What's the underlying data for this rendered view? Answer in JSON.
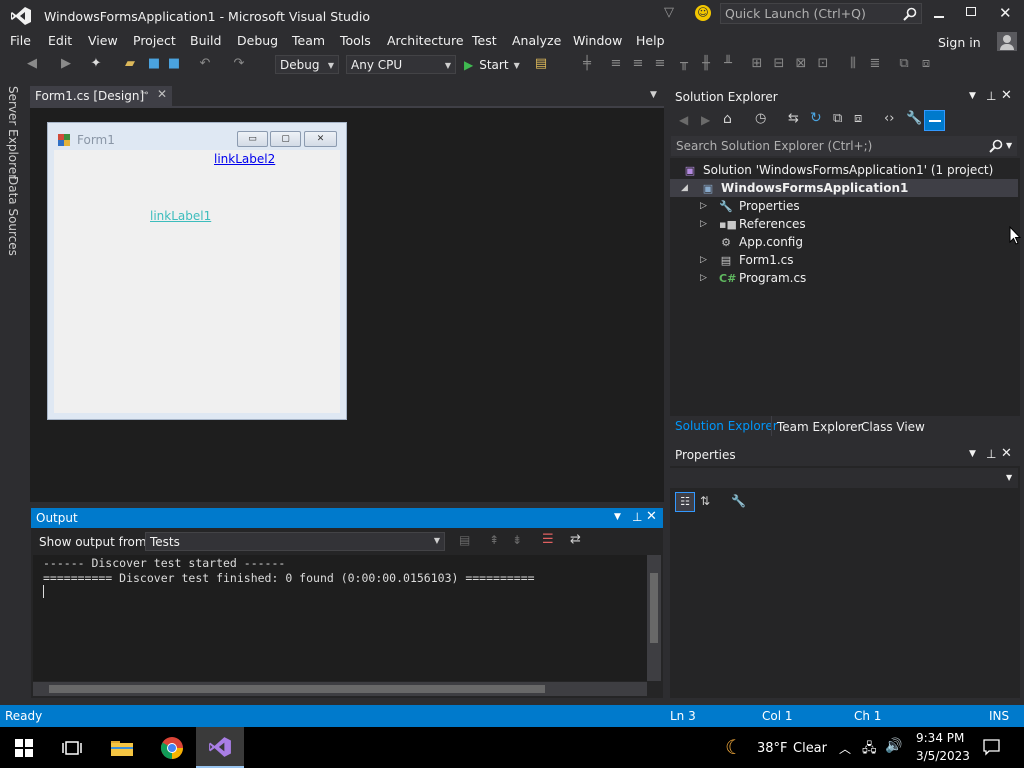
{
  "window": {
    "title": "WindowsFormsApplication1 - Microsoft Visual Studio",
    "quick_launch_placeholder": "Quick Launch (Ctrl+Q)",
    "sign_in": "Sign in"
  },
  "menu": [
    "File",
    "Edit",
    "View",
    "Project",
    "Build",
    "Debug",
    "Team",
    "Tools",
    "Architecture",
    "Test",
    "Analyze",
    "Window",
    "Help"
  ],
  "toolbar": {
    "configuration": "Debug",
    "platform": "Any CPU",
    "start_label": "Start"
  },
  "left_tabs": [
    "Server Explorer",
    "Data Sources"
  ],
  "document_tab": {
    "label": "Form1.cs [Design]"
  },
  "designer": {
    "form_title": "Form1",
    "link_label_2": "linkLabel2",
    "link_label_1": "linkLabel1"
  },
  "output": {
    "title": "Output",
    "show_output_from_label": "Show output from:",
    "source": "Tests",
    "lines": [
      "------ Discover test started ------",
      "========== Discover test finished: 0 found (0:00:00.0156103) =========="
    ]
  },
  "solution_explorer": {
    "title": "Solution Explorer",
    "search_placeholder": "Search Solution Explorer (Ctrl+;)",
    "solution": "Solution 'WindowsFormsApplication1' (1 project)",
    "project": "WindowsFormsApplication1",
    "items": [
      "Properties",
      "References",
      "App.config",
      "Form1.cs",
      "Program.cs"
    ],
    "tabs": [
      "Solution Explorer",
      "Team Explorer",
      "Class View"
    ]
  },
  "properties": {
    "title": "Properties"
  },
  "statusbar": {
    "status": "Ready",
    "line": "Ln 3",
    "col": "Col 1",
    "ch": "Ch 1",
    "mode": "INS"
  },
  "taskbar": {
    "weather_temp": "38°F",
    "weather_desc": "Clear",
    "time": "9:34 PM",
    "date": "3/5/2023"
  },
  "colors": {
    "accent": "#007acc",
    "background": "#2d2d30",
    "link": "#0000ee"
  }
}
